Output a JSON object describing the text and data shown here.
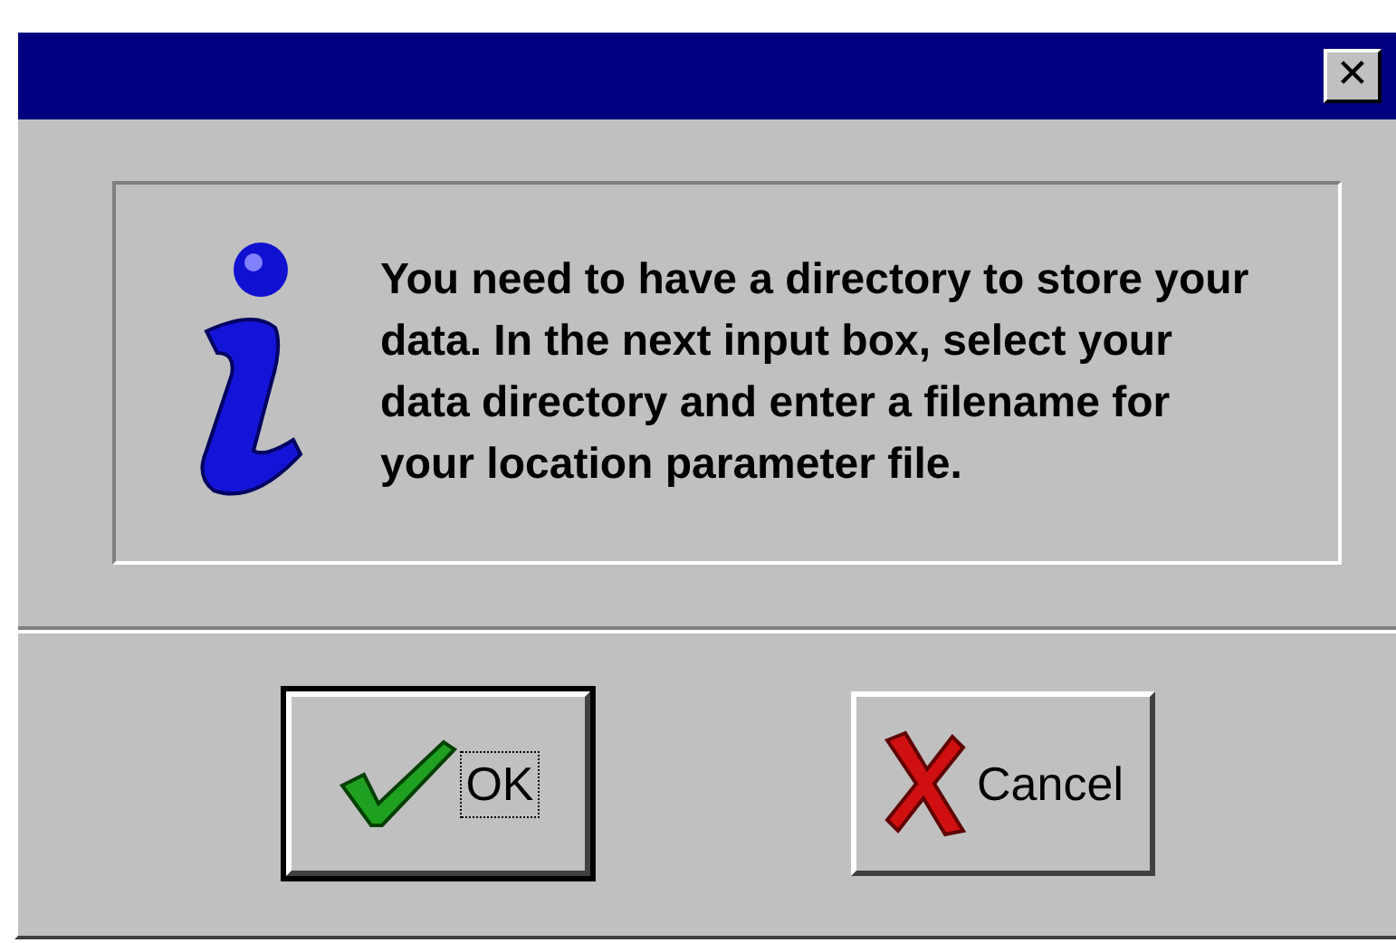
{
  "window": {
    "close": "✕"
  },
  "message": "You need to have a directory to store your data. In the next input box, select your data directory and enter a filename for your location parameter file.",
  "buttons": [
    {
      "label": "OK",
      "kind": "ok",
      "default": true
    },
    {
      "label": "Cancel",
      "kind": "cancel",
      "default": false
    }
  ]
}
